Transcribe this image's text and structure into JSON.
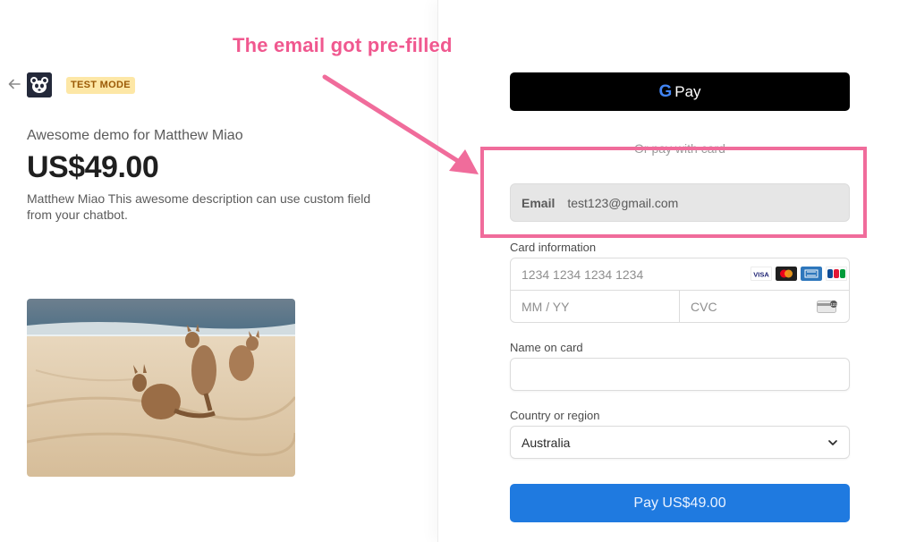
{
  "annotation": {
    "text": "The email got pre-filled",
    "color": "#f0588f"
  },
  "header": {
    "test_mode_badge": "TEST MODE"
  },
  "product": {
    "name": "Awesome demo for Matthew Miao",
    "price": "US$49.00",
    "description": "Matthew Miao This awesome description can use custom field from your chatbot.",
    "image": "kangaroos-on-beach-photo"
  },
  "payment": {
    "gpay_label": "Pay",
    "gpay_g": "G",
    "or_label": "Or pay with card",
    "email": {
      "label": "Email",
      "value": "test123@gmail.com"
    },
    "card": {
      "label": "Card information",
      "number_placeholder": "1234 1234 1234 1234",
      "expiry_placeholder": "MM / YY",
      "cvc_placeholder": "CVC",
      "brands": [
        "visa",
        "mastercard",
        "amex",
        "jcb"
      ]
    },
    "name_on_card": {
      "label": "Name on card",
      "value": ""
    },
    "country": {
      "label": "Country or region",
      "value": "Australia"
    },
    "pay_button": "Pay US$49.00"
  },
  "colors": {
    "pay_button": "#1f7ae0",
    "badge_bg": "#fde7a6",
    "badge_text": "#9b5a06",
    "annotation_pink": "#f06c9b"
  }
}
